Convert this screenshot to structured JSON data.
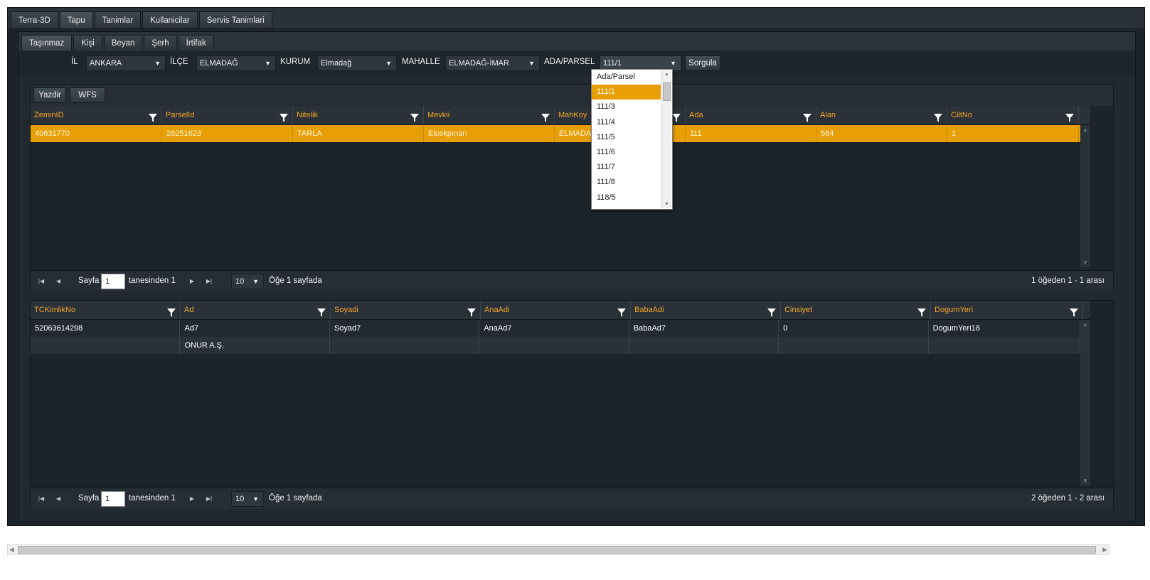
{
  "top_tabs": [
    "Terra-3D",
    "Tapu",
    "Tanimlar",
    "Kullanicilar",
    "Servis Tanimlari"
  ],
  "sub_tabs": [
    "Taşınmaz",
    "Kişi",
    "Beyan",
    "Şerh",
    "İrtifak"
  ],
  "filters": {
    "il_label": "İL",
    "il_value": "ANKARA",
    "ilce_label": "İLÇE",
    "ilce_value": "ELMADAĞ",
    "kurum_label": "KURUM",
    "kurum_value": "Elmadağ",
    "mahalle_label": "MAHALLE",
    "mahalle_value": "ELMADAĞ-İMAR",
    "ada_label": "ADA/PARSEL",
    "ada_value": "111/1",
    "query_button": "Sorgula"
  },
  "ada_dropdown": {
    "options": [
      "Ada/Parsel",
      "111/1",
      "111/3",
      "111/4",
      "111/5",
      "111/6",
      "111/7",
      "111/8",
      "118/5"
    ],
    "highlighted": "111/1"
  },
  "toolbar": {
    "print_label": "Yazdir",
    "wfs_label": "WFS"
  },
  "parcel_grid": {
    "columns": [
      "ZeminID",
      "ParselId",
      "Nitelik",
      "Mevkii",
      "MahKoy",
      "Ada",
      "Alan",
      "CiltNo"
    ],
    "rows": [
      [
        "40631770",
        "26251623",
        "TARLA",
        "Elcekpınarı",
        "ELMADAĞ",
        "111",
        "564",
        "1"
      ]
    ],
    "pager": {
      "page_label": "Sayfa",
      "page_value": "1",
      "of_label": "tanesinden 1",
      "page_size": "10",
      "per_page_label": "Öğe 1 sayfada",
      "summary": "1 öğeden 1 - 1 arası"
    }
  },
  "person_grid": {
    "columns": [
      "TCKimlikNo",
      "Ad",
      "Soyadi",
      "AnaAdi",
      "BabaAdi",
      "Cinsiyet",
      "DogumYeri"
    ],
    "rows": [
      [
        "52063614298",
        "Ad7",
        "Soyad7",
        "AnaAd7",
        "BabaAd7",
        "0",
        "DogumYeri18"
      ],
      [
        "",
        "ONUR A.Ş.",
        "",
        "",
        "",
        "",
        ""
      ]
    ],
    "pager": {
      "page_label": "Sayfa",
      "page_value": "1",
      "of_label": "tanesinden 1",
      "page_size": "10",
      "per_page_label": "Öğe 1 sayfada",
      "summary": "2 öğeden 1 - 2 arası"
    }
  },
  "colors": {
    "accent": "#e89f04",
    "header_text": "#f5a623",
    "background": "#1c232b"
  }
}
